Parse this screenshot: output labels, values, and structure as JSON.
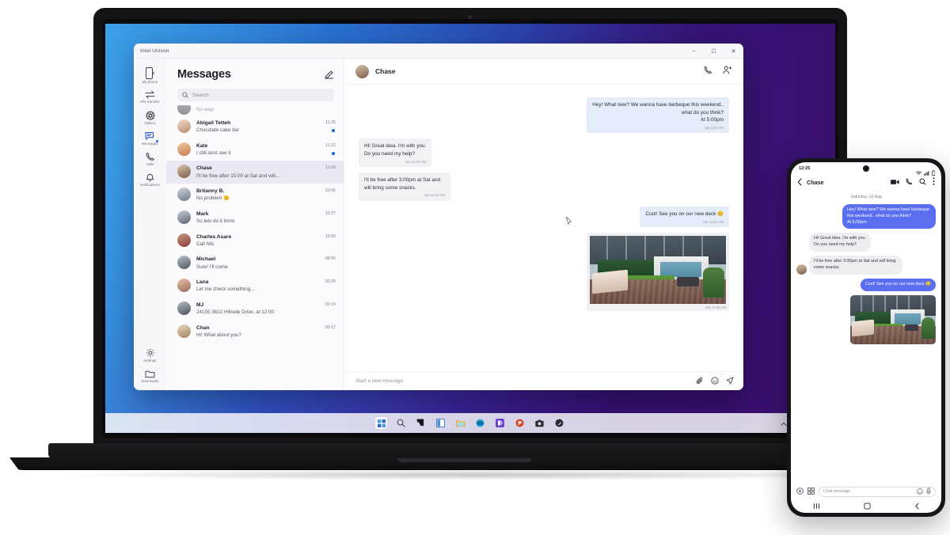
{
  "app": {
    "title": "Intel Unison",
    "window_controls": {
      "minimize": "–",
      "maximize": "☐",
      "close": "✕"
    },
    "sidebar": {
      "items": [
        {
          "label": "My phone",
          "icon": "phone-device-icon"
        },
        {
          "label": "File transfer",
          "icon": "transfer-arrows-icon"
        },
        {
          "label": "Gallery",
          "icon": "gallery-aperture-icon"
        },
        {
          "label": "Messages",
          "icon": "messages-bubble-icon"
        },
        {
          "label": "Calls",
          "icon": "phone-handset-icon"
        },
        {
          "label": "Notifications",
          "icon": "bell-icon"
        }
      ],
      "bottom_items": [
        {
          "label": "Settings",
          "icon": "gear-icon"
        },
        {
          "label": "Downloads",
          "icon": "folder-icon"
        }
      ]
    },
    "messages_panel": {
      "heading": "Messages",
      "compose_icon": "compose-pencil-icon",
      "search": {
        "placeholder": "Search",
        "value": "",
        "icon": "search-icon"
      },
      "conversations": [
        {
          "name": "",
          "preview": "No way!",
          "time": "",
          "unread": false
        },
        {
          "name": "Abigail Tetteh",
          "preview": "Chocolate cake da!",
          "time": "11:25",
          "unread": true
        },
        {
          "name": "Kate",
          "preview": "I still dont see it",
          "time": "11:22",
          "unread": true
        },
        {
          "name": "Chase",
          "preview": "I'll be free after 15:00 at Sat and will...",
          "time": "11:00",
          "unread": false
        },
        {
          "name": "Britanny B.",
          "preview": "No problem 😊",
          "time": "10:56",
          "unread": false
        },
        {
          "name": "Mark",
          "preview": "So lets do it tmrw",
          "time": "10:27",
          "unread": false
        },
        {
          "name": "Charles Asare",
          "preview": "Call hits",
          "time": "10:00",
          "unread": false
        },
        {
          "name": "Michael",
          "preview": "Sure! I'll come",
          "time": "08:55",
          "unread": false
        },
        {
          "name": "Lana",
          "preview": "Let me check something...",
          "time": "00:20",
          "unread": false
        },
        {
          "name": "MJ",
          "preview": "24155  3622 Hillside Drive, at 12:00",
          "time": "00:19",
          "unread": false
        },
        {
          "name": "Chan",
          "preview": "Hi! What about you?",
          "time": "00:17",
          "unread": false
        }
      ]
    },
    "thread": {
      "contact": "Chase",
      "header_actions": [
        {
          "icon": "phone-call-icon"
        },
        {
          "icon": "add-person-icon"
        }
      ],
      "messages": [
        {
          "dir": "out",
          "text": "Hey! What new? We wanna have barbeque this weekend.. what do you think?\nAt 5:00pm",
          "time": "Sat 3:10 AM"
        },
        {
          "dir": "in",
          "text": "Hi! Great idea. I'm with you.\nDo you need my help?",
          "time": "Sat 11:00 AM"
        },
        {
          "dir": "in",
          "text": "I'll be free after 3:00pm at Sat and will bring some snacks.",
          "time": "Sat 11:20 PM"
        },
        {
          "dir": "out",
          "text": "Cool! See you on our new deck 😊",
          "time": "Sat 11:22 AM"
        },
        {
          "dir": "out",
          "type": "image",
          "alt": "backyard-deck-photo",
          "time": "Sat 11:25 AM"
        }
      ],
      "composer": {
        "placeholder": "Start a new message",
        "value": "",
        "actions": [
          {
            "icon": "attachment-clip-icon"
          },
          {
            "icon": "emoji-smiley-icon"
          },
          {
            "icon": "send-icon"
          }
        ]
      }
    }
  },
  "taskbar": {
    "items": [
      {
        "icon": "windows-start-icon",
        "active": true
      },
      {
        "icon": "search-icon",
        "active": false
      },
      {
        "icon": "task-view-icon",
        "active": false
      },
      {
        "icon": "widgets-icon",
        "active": false
      },
      {
        "icon": "file-explorer-icon",
        "active": false
      },
      {
        "icon": "edge-browser-icon",
        "active": false
      },
      {
        "icon": "phone-link-icon",
        "active": false
      },
      {
        "icon": "powerpoint-icon",
        "active": false
      },
      {
        "icon": "camera-icon",
        "active": false
      },
      {
        "icon": "unison-app-icon",
        "active": false
      }
    ],
    "tray": [
      {
        "icon": "chevron-up-icon"
      },
      {
        "icon": "cloud-icon"
      },
      {
        "icon": "wifi-icon"
      },
      {
        "icon": "settings-gear-icon"
      }
    ]
  },
  "phone": {
    "status": {
      "time": "12:25",
      "indicators": [
        "wifi-icon",
        "signal-icon",
        "battery-icon"
      ]
    },
    "header": {
      "back_icon": "chevron-left-icon",
      "contact": "Chase",
      "actions": [
        {
          "icon": "video-camera-icon"
        },
        {
          "icon": "phone-call-icon"
        },
        {
          "icon": "search-icon"
        },
        {
          "icon": "overflow-menu-icon"
        }
      ]
    },
    "date_separator": "Saturday, 10 Aug",
    "messages": [
      {
        "dir": "out",
        "text": "Hey! What new? We wanna have barbeque this weekend.. what do you think?\nAt 5:00pm"
      },
      {
        "dir": "in",
        "text": "Hi! Great idea. I'm with you.\nDo you need my help?"
      },
      {
        "dir": "in",
        "text": "I'll be free after 3:00pm at Sat and will bring some snacks."
      },
      {
        "dir": "out",
        "text": "Cool! See you on our new deck 😊"
      },
      {
        "dir": "out",
        "type": "image",
        "alt": "backyard-deck-photo"
      }
    ],
    "input": {
      "placeholder": "Chat message",
      "value": "",
      "left_actions": [
        {
          "icon": "add-circle-icon"
        },
        {
          "icon": "gallery-grid-icon"
        }
      ],
      "right_actions": [
        {
          "icon": "emoji-smiley-icon"
        },
        {
          "icon": "microphone-icon"
        }
      ]
    },
    "nav": [
      {
        "icon": "recents-icon"
      },
      {
        "icon": "home-icon"
      },
      {
        "icon": "back-icon"
      }
    ]
  },
  "colors": {
    "accent_blue": "#1565d8",
    "bubble_out": "#e4edf9",
    "bubble_in": "#f2f2f5",
    "phone_bubble_out": "#5a6ff0",
    "wallpaper_start": "#3fa4e8",
    "wallpaper_end": "#33116e"
  }
}
